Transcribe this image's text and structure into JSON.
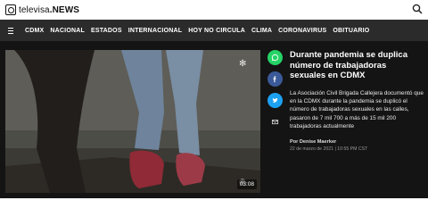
{
  "brand": {
    "name_light": "televisa",
    "name_bold": ".NEWS"
  },
  "nav": {
    "items": [
      "CDMX",
      "NACIONAL",
      "ESTADOS",
      "INTERNACIONAL",
      "HOY NO CIRCULA",
      "CLIMA",
      "CORONAVIRUS",
      "OBITUARIO"
    ]
  },
  "video": {
    "duration": "03:08"
  },
  "share": {
    "buttons": [
      {
        "name": "whatsapp",
        "color": "#25d366"
      },
      {
        "name": "facebook",
        "color": "#3b5998"
      },
      {
        "name": "twitter",
        "color": "#1da1f2"
      },
      {
        "name": "email",
        "color": "transparent"
      }
    ]
  },
  "article": {
    "headline": "Durante pandemia se duplica número de trabajadoras sexuales en CDMX",
    "summary": "La Asociación Civil Brigada Callejera documentó que en la CDMX durante la pandemia se duplicó el número de trabajadoras sexuales en las calles, pasaron de 7 mil 700 a más de 15 mil 200 trabajadoras actualmente",
    "author": "Por Denise Maerker",
    "date": "22 de marzo de 2021 | 10:55 PM CST"
  },
  "colors": {
    "navbar": "#2b2b2b",
    "background": "#141414"
  }
}
